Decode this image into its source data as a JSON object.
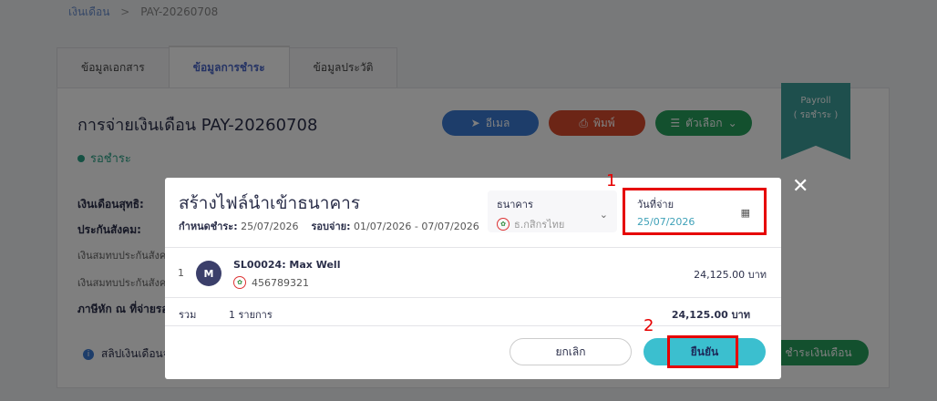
{
  "breadcrumb": {
    "root": "เงินเดือน",
    "separator": ">",
    "current": "PAY-20260708"
  },
  "tabs": [
    {
      "label": "ข้อมูลเอกสาร"
    },
    {
      "label": "ข้อมูลการชำระ"
    },
    {
      "label": "ข้อมูลประวัติ"
    }
  ],
  "page": {
    "title": "การจ่ายเงินเดือน PAY-20260708",
    "status": "รอชำระ",
    "email_label": "อีเมล",
    "print_label": "พิมพ์",
    "more_label": "ตัวเลือก",
    "ribbon_line1": "Payroll",
    "ribbon_line2": "( รอชำระ )",
    "net_salary_label": "เงินเดือนสุทธิ:",
    "social_security_label": "ประกันสังคม:",
    "ss_employee_label": "เงินสมทบประกันสังค",
    "ss_employer_label": "เงินสมทบประกันสังค",
    "withholding_label": "ภาษีหัก ณ ที่จ่ายรอบ",
    "info_text": "สลิปเงินเดือนจ",
    "pay_salary_label": "ชำระเงินเดือน"
  },
  "modal": {
    "title": "สร้างไฟล์นำเข้าธนาคาร",
    "due_label": "กำหนดชำระ:",
    "due_value": "25/07/2026",
    "period_label": "รอบจ่าย:",
    "period_value": "01/07/2026 - 07/07/2026",
    "bank_caption": "ธนาคาร",
    "bank_value": "ธ.กสิกรไทย",
    "date_caption": "วันที่จ่าย",
    "date_value": "25/07/2026",
    "annotation_1": "1",
    "annotation_2": "2",
    "rows": [
      {
        "index": "1",
        "avatar": "M",
        "name": "SL00024: Max Well",
        "account": "456789321",
        "amount": "24,125.00 บาท"
      }
    ],
    "total_label": "รวม",
    "total_count": "1 รายการ",
    "total_amount": "24,125.00 บาท",
    "cancel_label": "ยกเลิก",
    "confirm_label": "ยืนยัน",
    "close_symbol": "✕"
  },
  "colors": {
    "primary_blue": "#3a7bd5",
    "danger": "#d84a2c",
    "success": "#27a05d",
    "confirm": "#3bbfcf",
    "highlight": "#e60000"
  }
}
